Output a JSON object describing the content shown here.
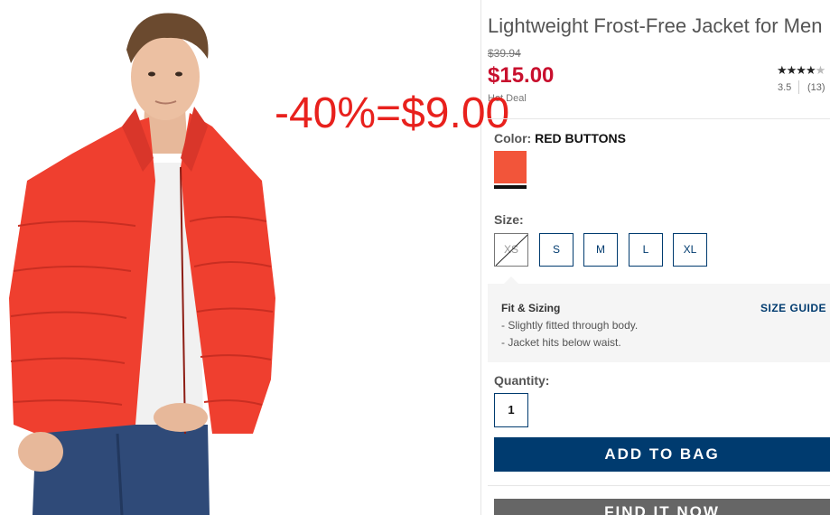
{
  "product": {
    "title": "Lightweight Frost-Free Jacket for Men",
    "old_price": "$39.94",
    "price": "$15.00",
    "deal_label": "Hot Deal",
    "rating": {
      "stars_filled": "★★★",
      "stars_half": "★",
      "stars_empty": "★",
      "value": "3.5",
      "count": "(13)"
    },
    "overlay_text": "-40%=$9.00"
  },
  "color": {
    "label": "Color:",
    "selected": "RED BUTTONS",
    "swatch_color": "#f2553a"
  },
  "size": {
    "label": "Size:",
    "options": [
      "XS",
      "S",
      "M",
      "L",
      "XL"
    ],
    "unavailable": [
      "XS"
    ]
  },
  "fit": {
    "title": "Fit & Sizing",
    "guide_label": "SIZE GUIDE",
    "lines": [
      "- Slightly fitted through body.",
      "- Jacket hits below waist."
    ]
  },
  "quantity": {
    "label": "Quantity:",
    "value": "1"
  },
  "actions": {
    "add_to_bag": "ADD TO BAG",
    "find_it_now": "FIND IT NOW"
  },
  "colors": {
    "brand_navy": "#003b6f",
    "sale_red": "#c8102e",
    "jacket_red": "#ef3f2f"
  }
}
